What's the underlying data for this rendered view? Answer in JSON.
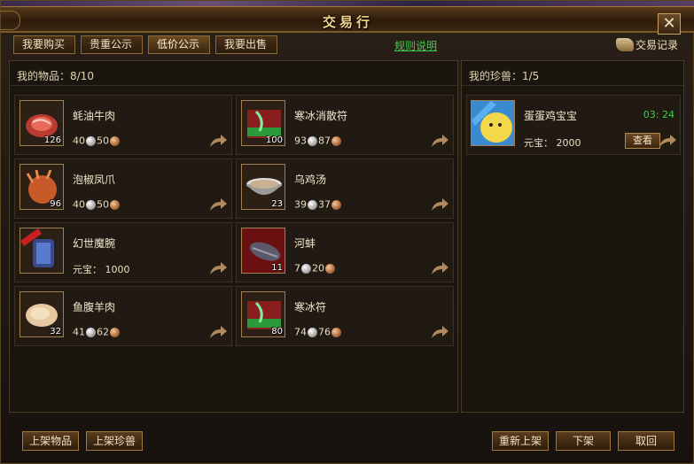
{
  "window": {
    "title": "交易行",
    "close_label": "✕"
  },
  "tabs": [
    {
      "label": "我要购买"
    },
    {
      "label": "贵重公示"
    },
    {
      "label": "低价公示"
    },
    {
      "label": "我要出售"
    }
  ],
  "rules_link": "规则说明",
  "history_label": "交易记录",
  "left_panel": {
    "header": "我的物品：8/10"
  },
  "right_panel": {
    "header": "我的珍兽：1/5"
  },
  "items": [
    {
      "name": "蚝油牛肉",
      "qty": "126",
      "silver": "40",
      "copper": "50",
      "icon": "beef-icon"
    },
    {
      "name": "寒冰消散符",
      "qty": "100",
      "silver": "93",
      "copper": "87",
      "icon": "scroll-icon"
    },
    {
      "name": "泡椒凤爪",
      "qty": "96",
      "silver": "40",
      "copper": "50",
      "icon": "chicken-claw-icon"
    },
    {
      "name": "乌鸡汤",
      "qty": "23",
      "silver": "39",
      "copper": "37",
      "icon": "soup-bowl-icon"
    },
    {
      "name": "幻世魔腕",
      "qty": "",
      "yuanbao": "元宝： 1000",
      "icon": "bracer-icon"
    },
    {
      "name": "河蚌",
      "qty": "11",
      "silver": "7",
      "copper": "20",
      "icon": "clam-icon"
    },
    {
      "name": "鱼腹羊肉",
      "qty": "32",
      "silver": "41",
      "copper": "62",
      "icon": "mutton-icon"
    },
    {
      "name": "寒冰符",
      "qty": "80",
      "silver": "74",
      "copper": "76",
      "icon": "scroll-icon"
    }
  ],
  "pet": {
    "name": "蛋蛋鸡宝宝",
    "time": "03: 24",
    "price": "元宝： 2000",
    "view_label": "查看",
    "icon": "chick-pet-icon"
  },
  "bottom_buttons": {
    "list_item": "上架物品",
    "list_pet": "上架珍兽",
    "relist": "重新上架",
    "delist": "下架",
    "withdraw": "取回"
  },
  "colors": {
    "accent_green": "#3cd04a",
    "border_gold": "#a0783a"
  }
}
